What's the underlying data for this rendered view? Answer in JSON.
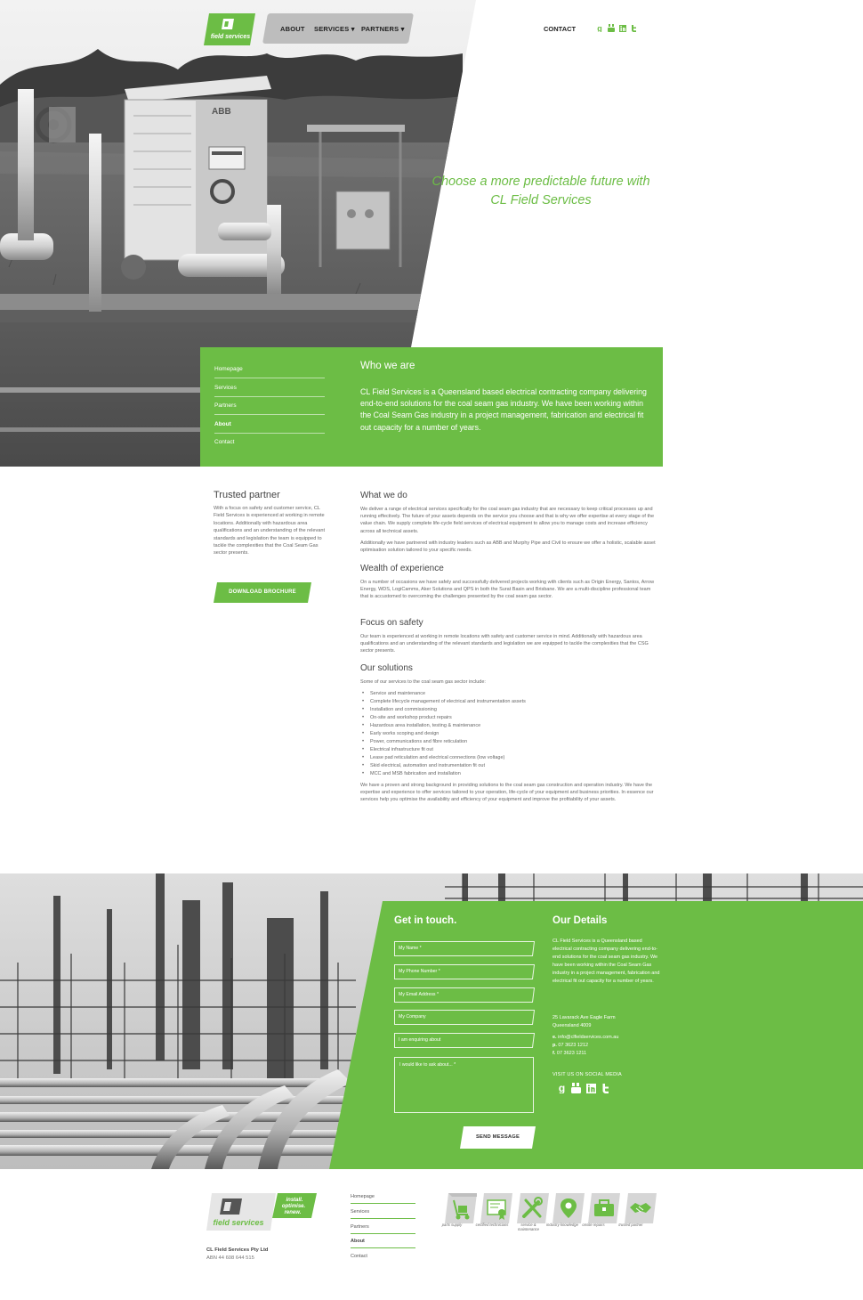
{
  "brand": {
    "logo_text": "field services",
    "logo_mark": "CL",
    "accent_color": "#6cbd45",
    "slogan": [
      "install.",
      "optimise.",
      "renew."
    ]
  },
  "nav": {
    "about": "ABOUT",
    "services": "SERVICES",
    "partners": "PARTNERS",
    "contact": "CONTACT",
    "dropdown_icon": "caret-down-icon",
    "social_icons": [
      "google-plus-icon",
      "youtube-icon",
      "linkedin-icon",
      "twitter-icon"
    ]
  },
  "hero": {
    "tagline": "Choose a more predictable future with CL Field Services"
  },
  "side_nav": {
    "items": [
      {
        "label": "Homepage"
      },
      {
        "label": "Services"
      },
      {
        "label": "Partners"
      },
      {
        "label": "About",
        "active": true
      },
      {
        "label": "Contact"
      }
    ]
  },
  "who": {
    "title": "Who we are",
    "text": "CL Field Services is a Queensland based electrical contracting company delivering end-to-end solutions for the coal seam gas industry. We have been working within the Coal Seam Gas industry in a project management, fabrication and electrical fit out capacity for a number of years."
  },
  "trusted": {
    "title": "Trusted partner",
    "text": "With a focus on safety and customer service, CL Field Services is experienced at working in remote locations. Additionally with hazardous area qualifications and an understanding of the relevant standards and legislation the team is equipped to tackle the complexities that the Coal Seam Gas sector presents.",
    "button": "DOWNLOAD BROCHURE"
  },
  "what": {
    "title": "What we do",
    "p1": "We deliver a range of electrical services specifically for the coal seam gas industry that are necessary to keep critical processes up and running effectively. The future of your assets depends on the service you choose and that is why we offer expertise at every stage of the value chain. We supply complete life-cycle field services of electrical equipment to allow you to manage costs and increase efficiency across all technical assets.",
    "p2": "Additionally we have partnered with industry leaders such as ABB and Murphy Pipe and Civil to ensure we offer a holistic, scalable asset optimisation solution tailored to your specific needs."
  },
  "wealth": {
    "title": "Wealth of experience",
    "text": "On a number of occasions we have safely and successfully delivered projects working with clients such as Origin Energy, Santos, Arrow Energy, WDS, LogiCamms, Aker Solutions and QPS in both the Surat Basin and Brisbane. We are a multi-discipline professional team that is accustomed to overcoming the challenges presented by the coal seam gas sector."
  },
  "safety": {
    "title": "Focus on safety",
    "text": "Our team is experienced at working in remote locations with safety and customer service in mind. Additionally with hazardous area qualifications and an understanding of the relevant standards and legislation we are equipped to tackle the complexities that the CSG sector presents."
  },
  "solutions": {
    "title": "Our solutions",
    "intro": "Some of our services to the coal seam gas sector include:",
    "items": [
      "Service and maintenance",
      "Complete lifecycle management of electrical and instrumentation assets",
      "Installation and commissioning",
      "On-site and workshop product repairs",
      "Hazardous area installation, testing & maintenance",
      "Early works scoping and design",
      "Power, communications and fibre reticulation",
      "Electrical infrastructure fit out",
      "Lease pad reticulation and electrical connections (low voltage)",
      "Skid electrical, automation and instrumentation fit out",
      "MCC and MSB fabrication and installation"
    ],
    "outro": "We have a proven and strong background in providing solutions to the coal seam gas construction and operation industry. We have the expertise and experience to offer services tailored to your operation, life-cycle of your equipment and business priorities. In essence our services help you optimise the availability and efficiency of your equipment and improve the profitability of your assets."
  },
  "contact_form": {
    "title": "Get in touch.",
    "name_placeholder": "My Name *",
    "phone_placeholder": "My Phone Number *",
    "email_placeholder": "My Email Address *",
    "company_placeholder": "My Company",
    "enquiry_placeholder": "I am enquiring about",
    "message_placeholder": "I would like to ask about... *",
    "send": "SEND MESSAGE"
  },
  "details": {
    "title": "Our Details",
    "text": "CL Field Services is a Queensland based electrical contracting company delivering end-to-end solutions for the coal seam gas industry. We have been working within the Coal Seam Gas industry in a project management, fabrication and electrical fit out capacity for a number of years.",
    "address_line1": "25 Lavarack Ave Eagle Farm",
    "address_line2": "Queensland 4009",
    "email_prefix": "e.",
    "email": "info@clfieldservices.com.au",
    "phone_prefix": "p.",
    "phone": "07 3623 1212",
    "fax_prefix": "f.",
    "fax": "07 3623 1211",
    "social_label": "VISIT US ON SOCIAL MEDIA"
  },
  "footer": {
    "company": "CL Field Services Pty Ltd",
    "abn": "ABN 44 608 644 515",
    "links": [
      {
        "label": "Homepage"
      },
      {
        "label": "Services"
      },
      {
        "label": "Partners"
      },
      {
        "label": "About",
        "active": true
      },
      {
        "label": "Contact"
      }
    ],
    "badges": [
      {
        "label": "parts supply",
        "icon": "trolley-icon"
      },
      {
        "label": "certified technicians",
        "icon": "certificate-icon"
      },
      {
        "label": "service & maintenance",
        "icon": "tools-icon"
      },
      {
        "label": "industry knowledge",
        "icon": "location-pin-icon"
      },
      {
        "label": "onsite repairs",
        "icon": "toolbox-icon"
      },
      {
        "label": "trusted partner",
        "icon": "handshake-icon"
      }
    ]
  }
}
